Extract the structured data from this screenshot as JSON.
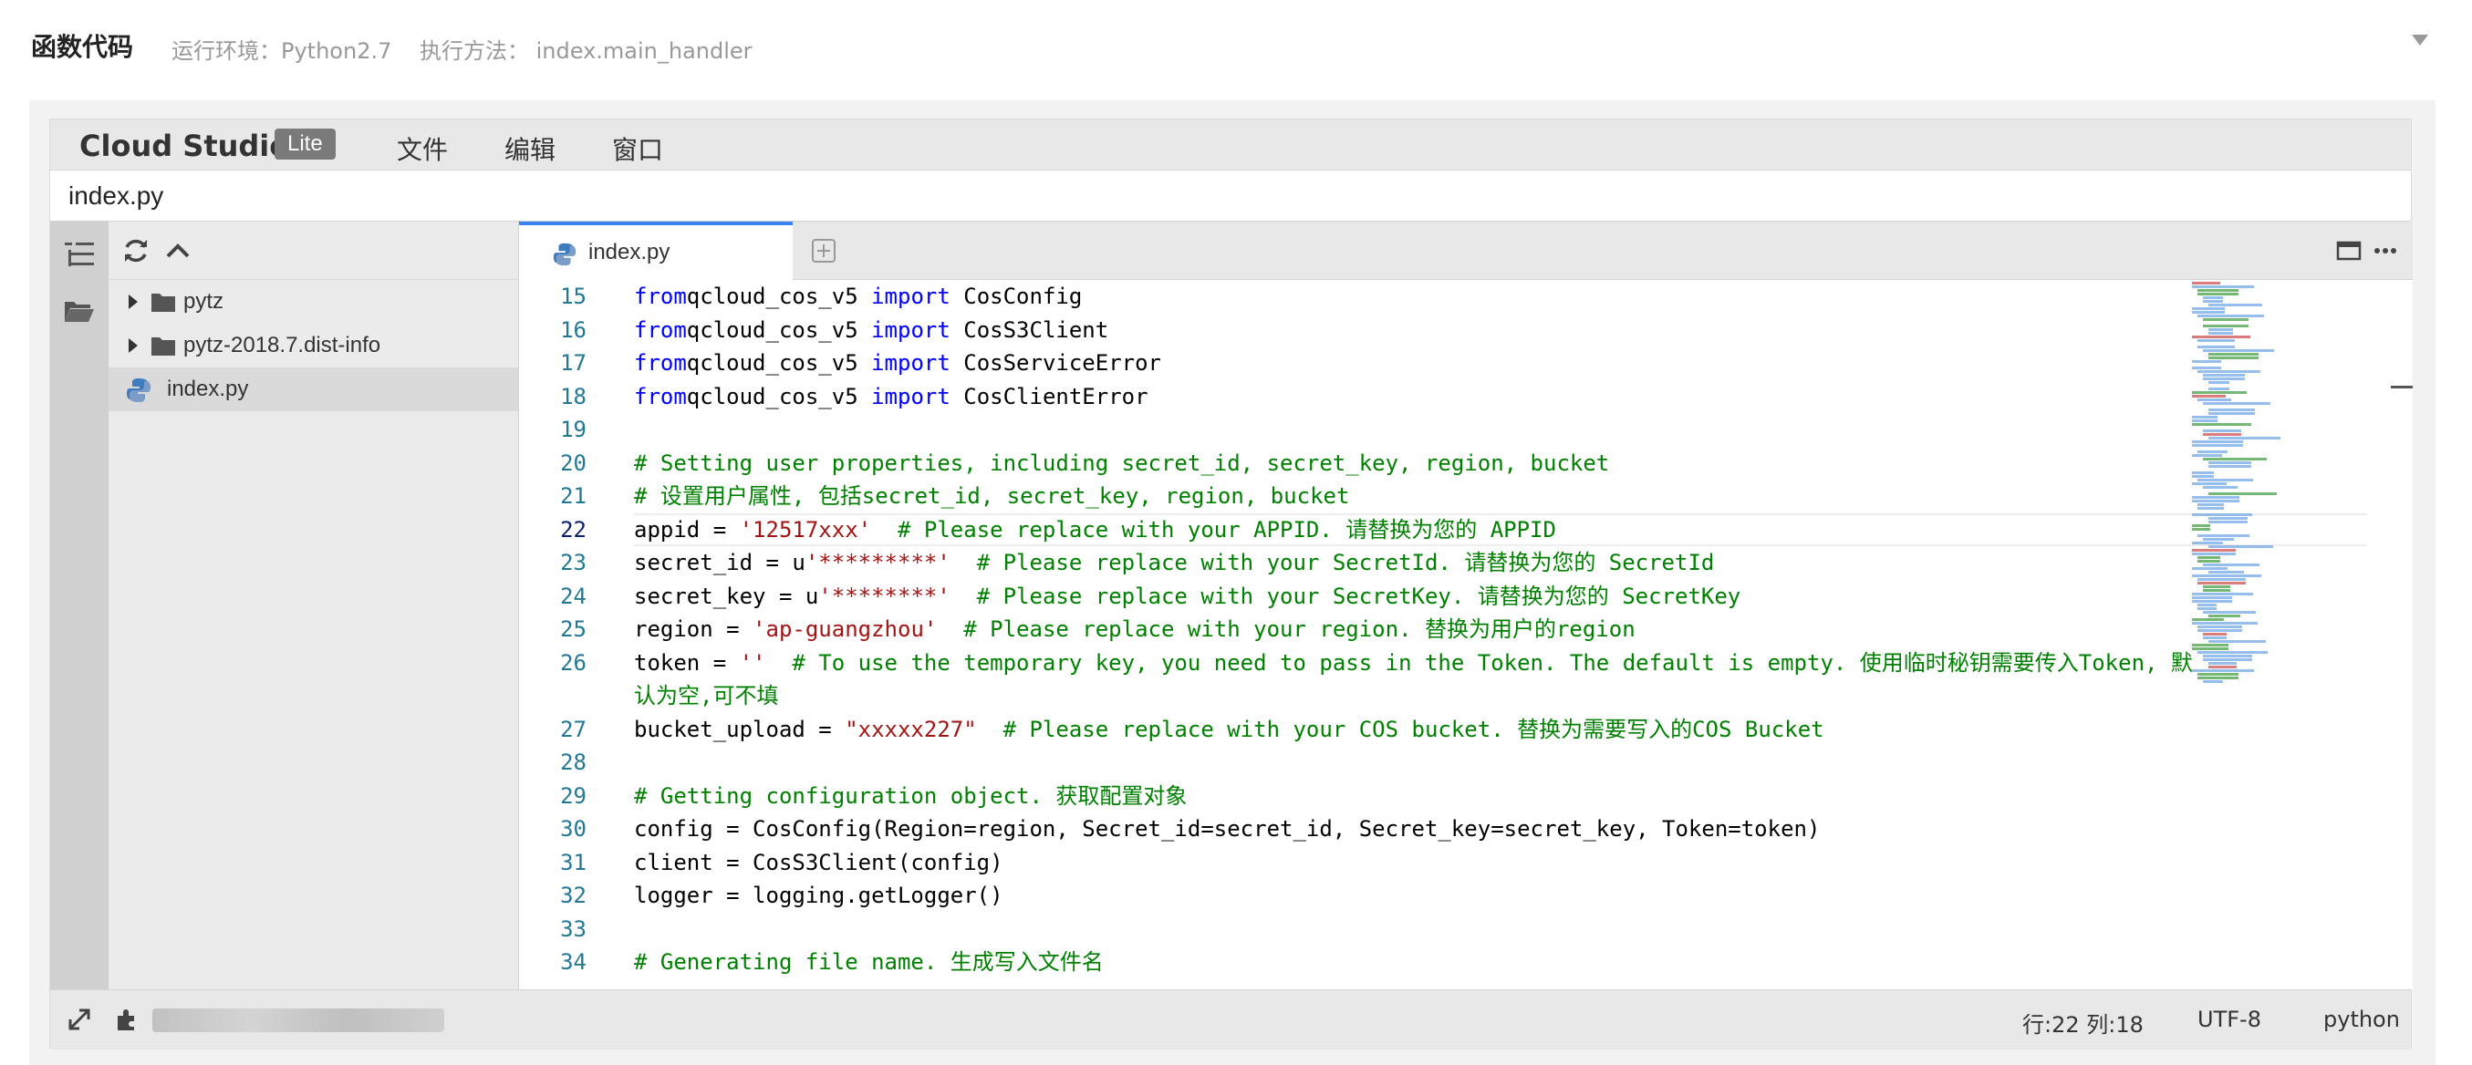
{
  "page": {
    "title": "函数代码",
    "env": "运行环境：Python2.7",
    "method": "执行方法：  index.main_handler"
  },
  "ide": {
    "brand": "Cloud Studio",
    "badge": "Lite",
    "menu": [
      "文件",
      "编辑",
      "窗口"
    ],
    "path": "index.py"
  },
  "sidebar": {
    "items": [
      {
        "label": "pytz",
        "type": "folder"
      },
      {
        "label": "pytz-2018.7.dist-info",
        "type": "folder"
      },
      {
        "label": "index.py",
        "type": "file",
        "selected": true
      }
    ]
  },
  "editor": {
    "tab_label": "index.py",
    "current_line": 22,
    "lines": [
      {
        "n": "15",
        "tokens": [
          [
            "kw",
            "from"
          ],
          [
            "",
            "qcloud_cos_v5 "
          ],
          [
            "kw",
            "import"
          ],
          [
            "",
            " CosConfig"
          ]
        ]
      },
      {
        "n": "16",
        "tokens": [
          [
            "kw",
            "from"
          ],
          [
            "",
            "qcloud_cos_v5 "
          ],
          [
            "kw",
            "import"
          ],
          [
            "",
            " CosS3Client"
          ]
        ]
      },
      {
        "n": "17",
        "tokens": [
          [
            "kw",
            "from"
          ],
          [
            "",
            "qcloud_cos_v5 "
          ],
          [
            "kw",
            "import"
          ],
          [
            "",
            " CosServiceError"
          ]
        ]
      },
      {
        "n": "18",
        "tokens": [
          [
            "kw",
            "from"
          ],
          [
            "",
            "qcloud_cos_v5 "
          ],
          [
            "kw",
            "import"
          ],
          [
            "",
            " CosClientError"
          ]
        ]
      },
      {
        "n": "19",
        "tokens": []
      },
      {
        "n": "20",
        "tokens": [
          [
            "cm",
            "# Setting user properties, including secret_id, secret_key, region, bucket"
          ]
        ]
      },
      {
        "n": "21",
        "tokens": [
          [
            "cm",
            "# 设置用户属性, 包括secret_id, secret_key, region, bucket"
          ]
        ]
      },
      {
        "n": "22",
        "tokens": [
          [
            "",
            "appid = "
          ],
          [
            "str",
            "'12517xxx'"
          ],
          [
            "cm",
            "  # Please replace with your APPID. 请替换为您的 APPID"
          ]
        ]
      },
      {
        "n": "23",
        "tokens": [
          [
            "",
            "secret_id = u"
          ],
          [
            "str",
            "'*********'"
          ],
          [
            "cm",
            "  # Please replace with your SecretId. 请替换为您的 SecretId"
          ]
        ]
      },
      {
        "n": "24",
        "tokens": [
          [
            "",
            "secret_key = u"
          ],
          [
            "str",
            "'********'"
          ],
          [
            "cm",
            "  # Please replace with your SecretKey. 请替换为您的 SecretKey"
          ]
        ]
      },
      {
        "n": "25",
        "tokens": [
          [
            "",
            "region = "
          ],
          [
            "str",
            "'ap-guangzhou'"
          ],
          [
            "cm",
            "  # Please replace with your region. 替换为用户的region"
          ]
        ]
      },
      {
        "n": "26",
        "tokens": [
          [
            "",
            "token = "
          ],
          [
            "str",
            "''"
          ],
          [
            "cm",
            "  # To use the temporary key, you need to pass in the Token. The default is empty. 使用临时秘钥需要传入Token, 默"
          ]
        ]
      },
      {
        "n": "",
        "tokens": [
          [
            "cm",
            "认为空,可不填"
          ]
        ]
      },
      {
        "n": "27",
        "tokens": [
          [
            "",
            "bucket_upload = "
          ],
          [
            "str",
            "\"xxxxx227\""
          ],
          [
            "cm",
            "  # Please replace with your COS bucket. 替换为需要写入的COS Bucket"
          ]
        ]
      },
      {
        "n": "28",
        "tokens": []
      },
      {
        "n": "29",
        "tokens": [
          [
            "cm",
            "# Getting configuration object. 获取配置对象"
          ]
        ]
      },
      {
        "n": "30",
        "tokens": [
          [
            "",
            "config = CosConfig(Region=region, Secret_id=secret_id, Secret_key=secret_key, Token=token)"
          ]
        ]
      },
      {
        "n": "31",
        "tokens": [
          [
            "",
            "client = CosS3Client(config)"
          ]
        ]
      },
      {
        "n": "32",
        "tokens": [
          [
            "",
            "logger = logging.getLogger()"
          ]
        ]
      },
      {
        "n": "33",
        "tokens": []
      },
      {
        "n": "34",
        "tokens": [
          [
            "cm",
            "# Generating file name. 生成写入文件名"
          ]
        ]
      }
    ]
  },
  "status": {
    "position": "行:22 列:18",
    "encoding": "UTF-8",
    "language": "python"
  }
}
